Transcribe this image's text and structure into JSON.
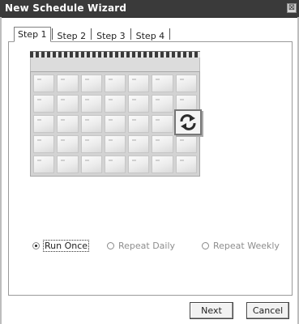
{
  "window": {
    "title": "New Schedule Wizard",
    "close_glyph": "⊠"
  },
  "tabs": [
    {
      "label": "Step 1",
      "active": true
    },
    {
      "label": "Step 2",
      "active": false
    },
    {
      "label": "Step 3",
      "active": false
    },
    {
      "label": "Step 4",
      "active": false
    }
  ],
  "illustration": {
    "name": "calendar-icon",
    "overlay_icon": "refresh-icon"
  },
  "schedule_options": [
    {
      "label": "Run Once",
      "selected": true,
      "enabled": true
    },
    {
      "label": "Repeat Daily",
      "selected": false,
      "enabled": false
    },
    {
      "label": "Repeat Weekly",
      "selected": false,
      "enabled": false
    }
  ],
  "buttons": {
    "next": "Next",
    "cancel": "Cancel"
  }
}
